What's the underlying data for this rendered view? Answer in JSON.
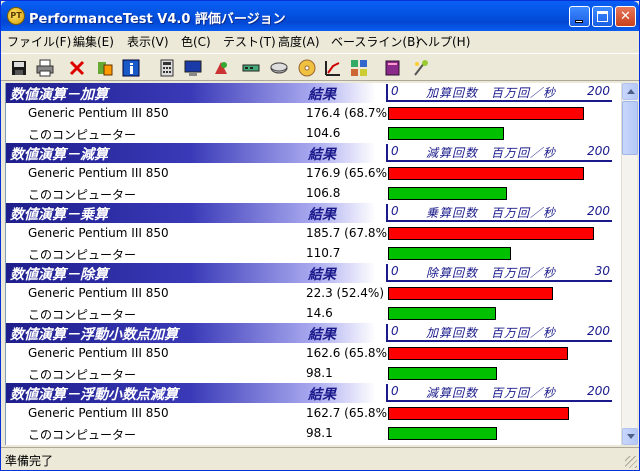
{
  "window": {
    "title": "PerformanceTest V4.0 評価バージョン",
    "icon_text": "PT"
  },
  "menu": [
    "ファイル(F)",
    "編集(E)",
    "表示(V)",
    "色(C)",
    "テスト(T)",
    "高度(A)",
    "ベースライン(B)",
    "ヘルプ(H)"
  ],
  "toolbar_icons": [
    "save-icon",
    "print-icon",
    "delete-icon",
    "compare-icon",
    "info-icon",
    "calculator-icon",
    "monitor-icon",
    "graphics-icon",
    "memory-icon",
    "disk-icon",
    "cd-icon",
    "chart-icon",
    "network-icon",
    "book-icon",
    "wizard-icon"
  ],
  "colors": {
    "reference_bar": "#ff0000",
    "this_computer_bar": "#00c000",
    "header_blue": "#1a1a8c"
  },
  "result_header": "結果",
  "reference_label": "Generic Pentium III 850",
  "this_computer_label": "このコンピューター",
  "sections": [
    {
      "title": "数値演算－加算",
      "scale_zero": "0",
      "scale_label": "加算回数　百万回／秒",
      "scale_max": "200",
      "max": 200,
      "ref_value": 176.4,
      "ref_text": "176.4 (68.7%)",
      "mine_value": 104.6,
      "mine_text": "104.6"
    },
    {
      "title": "数値演算－減算",
      "scale_zero": "0",
      "scale_label": "減算回数　百万回／秒",
      "scale_max": "200",
      "max": 200,
      "ref_value": 176.9,
      "ref_text": "176.9 (65.6%)",
      "mine_value": 106.8,
      "mine_text": "106.8"
    },
    {
      "title": "数値演算－乗算",
      "scale_zero": "0",
      "scale_label": "乗算回数　百万回／秒",
      "scale_max": "200",
      "max": 200,
      "ref_value": 185.7,
      "ref_text": "185.7 (67.8%)",
      "mine_value": 110.7,
      "mine_text": "110.7"
    },
    {
      "title": "数値演算－除算",
      "scale_zero": "0",
      "scale_label": "除算回数　百万回／秒",
      "scale_max": "30",
      "max": 30,
      "ref_value": 22.3,
      "ref_text": "22.3 (52.4%)",
      "mine_value": 14.6,
      "mine_text": "14.6"
    },
    {
      "title": "数値演算－浮動小数点加算",
      "scale_zero": "0",
      "scale_label": "加算回数　百万回／秒",
      "scale_max": "200",
      "max": 200,
      "ref_value": 162.6,
      "ref_text": "162.6 (65.8%)",
      "mine_value": 98.1,
      "mine_text": "98.1"
    },
    {
      "title": "数値演算－浮動小数点減算",
      "scale_zero": "0",
      "scale_label": "減算回数　百万回／秒",
      "scale_max": "200",
      "max": 200,
      "ref_value": 162.7,
      "ref_text": "162.7 (65.8%)",
      "mine_value": 98.1,
      "mine_text": "98.1"
    }
  ],
  "status": "準備完了"
}
